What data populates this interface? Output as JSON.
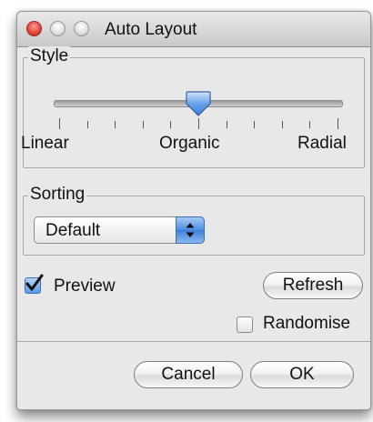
{
  "window": {
    "title": "Auto Layout"
  },
  "style_group": {
    "label": "Style",
    "slider": {
      "value": 0.5,
      "min_label": "Linear",
      "mid_label": "Organic",
      "max_label": "Radial",
      "tick_count": 11
    }
  },
  "sorting_group": {
    "label": "Sorting",
    "selected": "Default"
  },
  "preview": {
    "label": "Preview",
    "checked": true
  },
  "refresh_button": {
    "label": "Refresh"
  },
  "randomise": {
    "label": "Randomise",
    "checked": false
  },
  "footer": {
    "cancel_label": "Cancel",
    "ok_label": "OK"
  },
  "colors": {
    "close_light": "#e14a3f",
    "accent_blue": "#4b8ee5"
  }
}
